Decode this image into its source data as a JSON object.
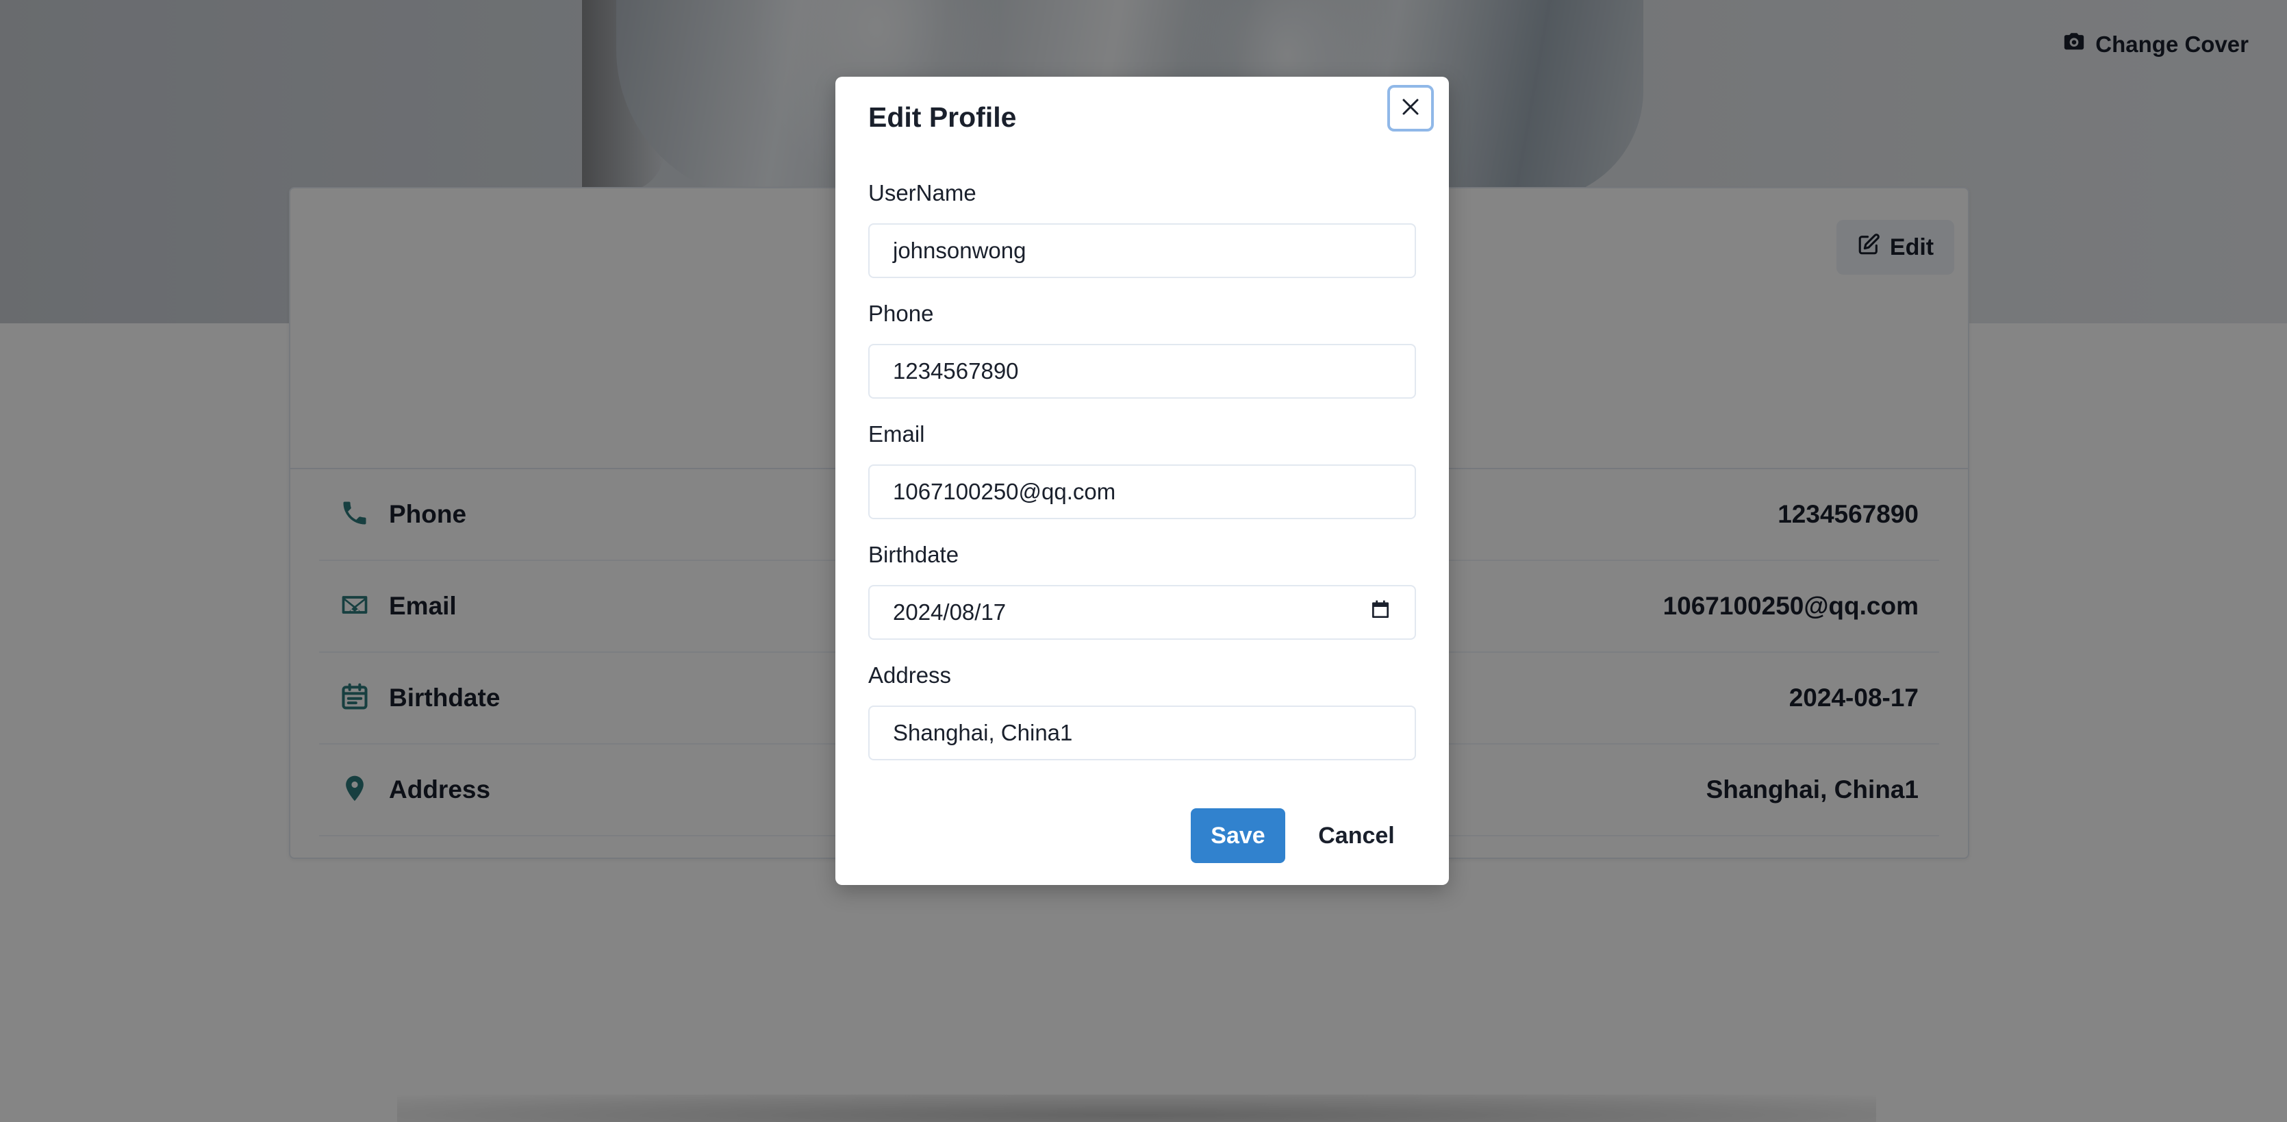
{
  "cover": {
    "change_cover_label": "Change Cover",
    "change_cover_icon": "camera-icon"
  },
  "card": {
    "edit_label": "Edit",
    "edit_icon": "edit-icon",
    "rows": [
      {
        "icon": "phone-icon",
        "label": "Phone",
        "value": "1234567890"
      },
      {
        "icon": "mail-icon",
        "label": "Email",
        "value": "1067100250@qq.com"
      },
      {
        "icon": "calendar-icon",
        "label": "Birthdate",
        "value": "2024-08-17"
      },
      {
        "icon": "map-pin-icon",
        "label": "Address",
        "value": "Shanghai, China1"
      }
    ]
  },
  "modal": {
    "title": "Edit Profile",
    "close_icon": "close-icon",
    "fields": {
      "username": {
        "label": "UserName",
        "value": "johnsonwong"
      },
      "phone": {
        "label": "Phone",
        "value": "1234567890"
      },
      "email": {
        "label": "Email",
        "value": "1067100250@qq.com"
      },
      "birthdate": {
        "label": "Birthdate",
        "value": "2024/08/17",
        "icon": "calendar-icon"
      },
      "address": {
        "label": "Address",
        "value": "Shanghai, China1"
      }
    },
    "save_label": "Save",
    "cancel_label": "Cancel"
  },
  "colors": {
    "accent": "#3182ce",
    "icon_teal": "#2c7a7b",
    "focus_ring": "#90b8e8"
  }
}
